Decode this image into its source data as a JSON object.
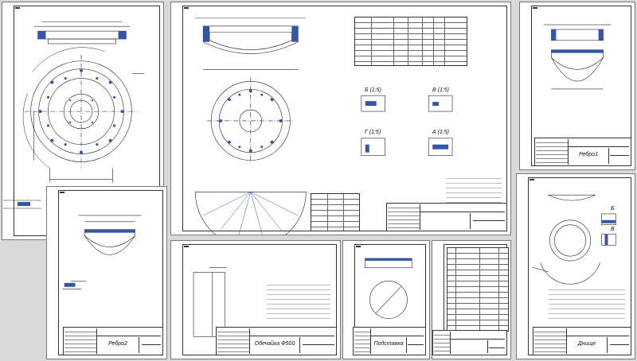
{
  "sheets": {
    "s1": {
      "tag": "",
      "rough": "",
      "title": ""
    },
    "s2": {
      "tag": "",
      "rough": "",
      "title": "",
      "sections": [
        "Б (1:5)",
        "В (1:5)",
        "Г (1:5)",
        "А (1:5)"
      ]
    },
    "s3": {
      "tag": "",
      "rough": "",
      "title": "Ребро1",
      "side": ""
    },
    "s4": {
      "tag": "",
      "rough": "",
      "title": "Ребро2"
    },
    "s5": {
      "tag": "",
      "rough": "",
      "title": "Обечайка Ф500"
    },
    "s6": {
      "tag": "",
      "rough": "",
      "title": "Подставка"
    },
    "s7": {
      "tag": "",
      "title": ""
    },
    "s8": {
      "tag": "",
      "rough": "",
      "title": "Днище",
      "labels": [
        "Б",
        "В"
      ]
    }
  },
  "colors": {
    "sheet_bg": "#ffffff",
    "bg": "#d9d9d9",
    "line": "#222222",
    "hatch": "#3355aa"
  }
}
